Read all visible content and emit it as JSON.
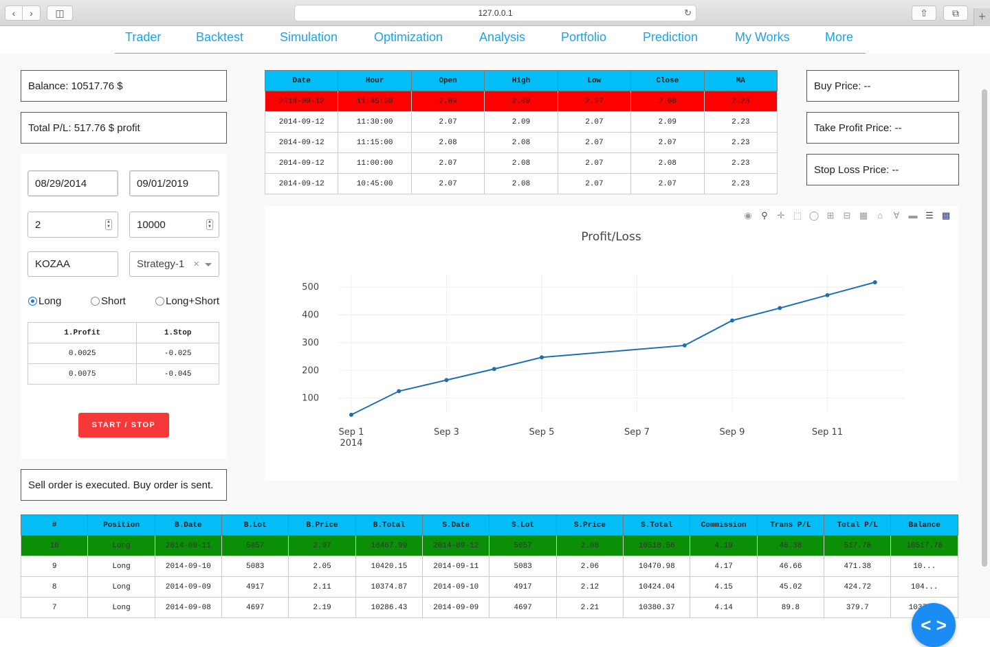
{
  "browser": {
    "url": "127.0.0.1"
  },
  "nav": [
    "Trader",
    "Backtest",
    "Simulation",
    "Optimization",
    "Analysis",
    "Portfolio",
    "Prediction",
    "My Works",
    "More"
  ],
  "left": {
    "balance": "Balance: 10517.76 $",
    "total_pl": "Total P/L: 517.76 $ profit",
    "start_date": "08/29/2014",
    "end_date": "09/01/2019",
    "lot": "2",
    "capital": "10000",
    "symbol": "KOZAA",
    "strategy": "Strategy-1",
    "radios": [
      "Long",
      "Short",
      "Long+Short"
    ],
    "selected_radio": "Long",
    "params_headers": [
      "1.Profit",
      "1.Stop"
    ],
    "params_rows": [
      [
        "0.0025",
        "-0.025"
      ],
      [
        "0.0075",
        "-0.045"
      ]
    ],
    "start_stop_label": "START / STOP",
    "status_message": "Sell order is executed. Buy order is sent."
  },
  "right": {
    "buy_price": "Buy Price: --",
    "take_profit": "Take Profit Price: --",
    "stop_loss": "Stop Loss Price: --"
  },
  "price_table": {
    "headers": [
      "Date",
      "Hour",
      "Open",
      "High",
      "Low",
      "Close",
      "MA"
    ],
    "rows": [
      [
        "2014-09-12",
        "11:45:00",
        "2.09",
        "2.09",
        "2.07",
        "2.08",
        "2.23"
      ],
      [
        "2014-09-12",
        "11:30:00",
        "2.07",
        "2.09",
        "2.07",
        "2.09",
        "2.23"
      ],
      [
        "2014-09-12",
        "11:15:00",
        "2.08",
        "2.08",
        "2.07",
        "2.07",
        "2.23"
      ],
      [
        "2014-09-12",
        "11:00:00",
        "2.07",
        "2.08",
        "2.07",
        "2.08",
        "2.23"
      ],
      [
        "2014-09-12",
        "10:45:00",
        "2.07",
        "2.08",
        "2.07",
        "2.07",
        "2.23"
      ]
    ],
    "highlight_color": "#ff0000"
  },
  "chart_data": {
    "type": "line",
    "title": "Profit/Loss",
    "xlabel": "",
    "ylabel": "",
    "x": [
      "2014-09-01",
      "2014-09-02",
      "2014-09-03",
      "2014-09-04",
      "2014-09-05",
      "2014-09-08",
      "2014-09-09",
      "2014-09-10",
      "2014-09-11",
      "2014-09-12"
    ],
    "series": [
      {
        "values": [
          40,
          125,
          165,
          205,
          247,
          290,
          380,
          424.72,
          471.38,
          517.76
        ]
      }
    ],
    "x_ticks": [
      {
        "date": "2014-09-01",
        "label": "Sep 1",
        "sub": "2014"
      },
      {
        "date": "2014-09-03",
        "label": "Sep 3"
      },
      {
        "date": "2014-09-05",
        "label": "Sep 5"
      },
      {
        "date": "2014-09-07",
        "label": "Sep 7"
      },
      {
        "date": "2014-09-09",
        "label": "Sep 9"
      },
      {
        "date": "2014-09-11",
        "label": "Sep 11"
      }
    ],
    "y_ticks": [
      100,
      200,
      300,
      400,
      500
    ],
    "xlim": [
      "2014-09-01",
      "2014-09-13"
    ],
    "ylim": [
      0,
      545
    ],
    "grid": true,
    "line_color": "#1f6fb0"
  },
  "trades_table": {
    "headers": [
      "#",
      "Position",
      "B.Date",
      "B.Lot",
      "B.Price",
      "B.Total",
      "S.Date",
      "S.Lot",
      "S.Price",
      "S.Total",
      "Commission",
      "Trans P/L",
      "Total P/L",
      "Balance"
    ],
    "rows": [
      [
        "10",
        "Long",
        "2014-09-11",
        "5057",
        "2.07",
        "10467.99",
        "2014-09-12",
        "5057",
        "2.08",
        "10518.56",
        "4.19",
        "46.38",
        "517.76",
        "10517.76"
      ],
      [
        "9",
        "Long",
        "2014-09-10",
        "5083",
        "2.05",
        "10420.15",
        "2014-09-11",
        "5083",
        "2.06",
        "10470.98",
        "4.17",
        "46.66",
        "471.38",
        "10..."
      ],
      [
        "8",
        "Long",
        "2014-09-09",
        "4917",
        "2.11",
        "10374.87",
        "2014-09-10",
        "4917",
        "2.12",
        "10424.04",
        "4.15",
        "45.02",
        "424.72",
        "104..."
      ],
      [
        "7",
        "Long",
        "2014-09-08",
        "4697",
        "2.19",
        "10286.43",
        "2014-09-09",
        "4697",
        "2.21",
        "10380.37",
        "4.14",
        "89.8",
        "379.7",
        "10379.7"
      ]
    ],
    "highlight_color": "#0a8f07"
  },
  "icons": [
    "back-icon",
    "forward-icon",
    "sidebar-icon",
    "reload-icon",
    "share-icon",
    "tabs-icon",
    "new-tab-icon",
    "camera-icon",
    "zoom-icon",
    "pan-icon",
    "box-select-icon",
    "lasso-icon",
    "zoom-in-icon",
    "zoom-out-icon",
    "autoscale-icon",
    "home-icon",
    "spike-icon",
    "hover-closest-icon",
    "hover-compare-icon",
    "plotly-logo-icon",
    "code-icon"
  ]
}
